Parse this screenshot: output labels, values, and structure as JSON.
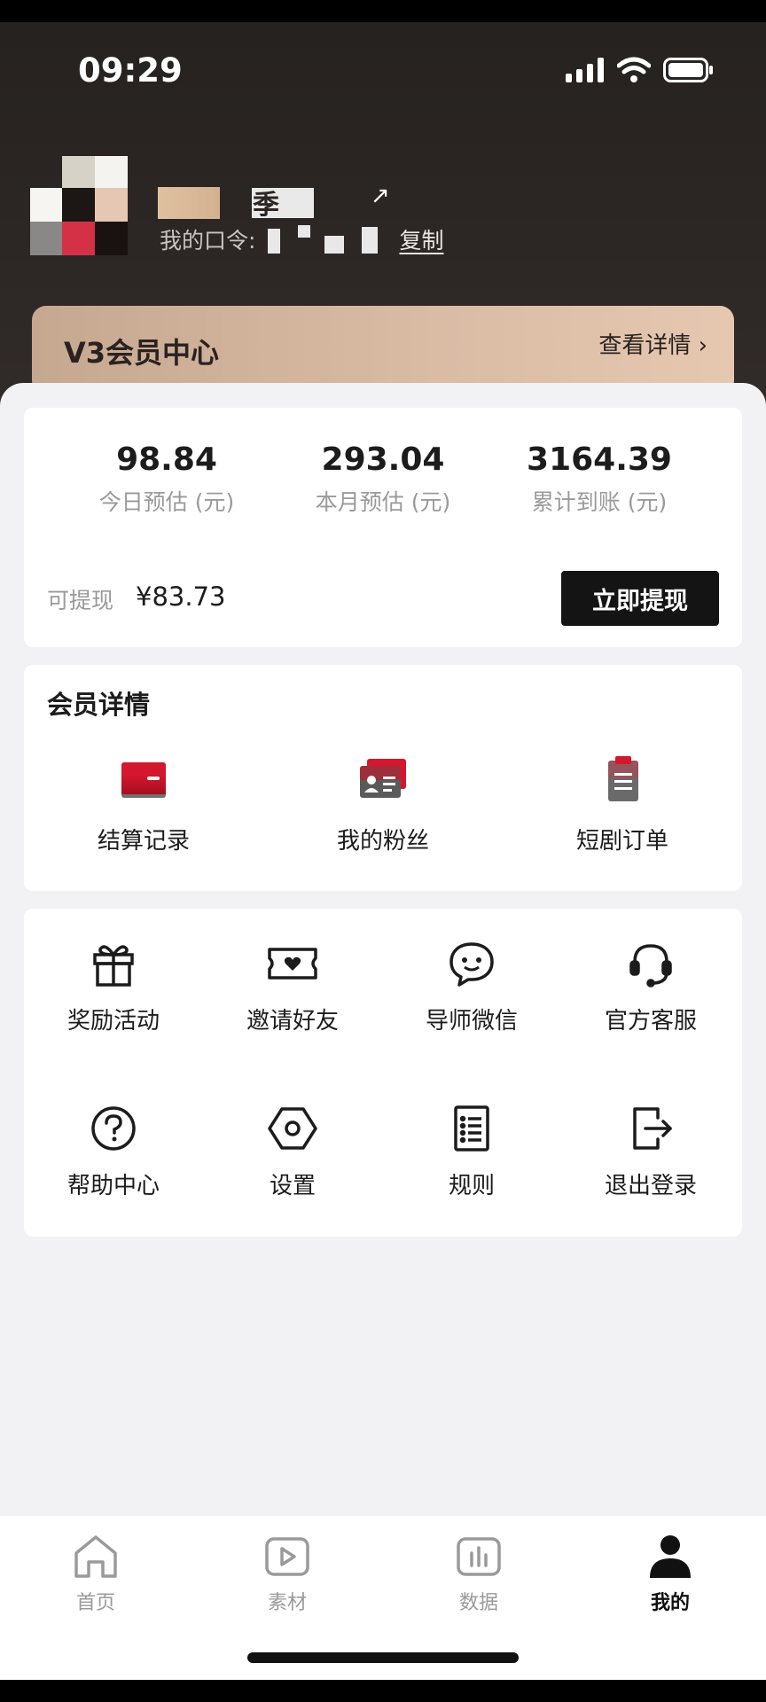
{
  "status_bar": {
    "time": "09:29"
  },
  "profile": {
    "nickname_visible": "季",
    "passcode_label": "我的口令:",
    "copy_label": "复制"
  },
  "vip": {
    "title": "V3会员中心",
    "more_label": "查看详情",
    "colors": {
      "gradient_start": "#c6a891",
      "gradient_end": "#e6c8b1"
    }
  },
  "earnings": {
    "stats": [
      {
        "value": "98.84",
        "label": "今日预估 (元)"
      },
      {
        "value": "293.04",
        "label": "本月预估 (元)"
      },
      {
        "value": "3164.39",
        "label": "累计到账 (元)"
      }
    ],
    "withdrawable_label": "可提现",
    "withdrawable_amount": "¥83.73",
    "withdraw_button": "立即提现"
  },
  "membership": {
    "title": "会员详情",
    "items": [
      {
        "label": "结算记录",
        "icon": "wallet-icon"
      },
      {
        "label": "我的粉丝",
        "icon": "fans-card-icon"
      },
      {
        "label": "短剧订单",
        "icon": "order-clipboard-icon"
      }
    ]
  },
  "tools": {
    "items": [
      {
        "label": "奖励活动",
        "icon": "gift-icon"
      },
      {
        "label": "邀请好友",
        "icon": "ticket-heart-icon"
      },
      {
        "label": "导师微信",
        "icon": "chat-bubble-icon"
      },
      {
        "label": "官方客服",
        "icon": "headset-icon"
      },
      {
        "label": "帮助中心",
        "icon": "help-circle-icon"
      },
      {
        "label": "设置",
        "icon": "settings-hexagon-icon"
      },
      {
        "label": "规则",
        "icon": "rules-list-icon"
      },
      {
        "label": "退出登录",
        "icon": "logout-icon"
      }
    ]
  },
  "bottom_nav": {
    "active": "我的",
    "items": [
      {
        "label": "首页",
        "icon": "home-icon"
      },
      {
        "label": "素材",
        "icon": "video-play-icon"
      },
      {
        "label": "数据",
        "icon": "bar-chart-icon"
      },
      {
        "label": "我的",
        "icon": "person-icon"
      }
    ]
  },
  "colors": {
    "accent_red": "#d4172e",
    "primary_dark": "#141414"
  }
}
